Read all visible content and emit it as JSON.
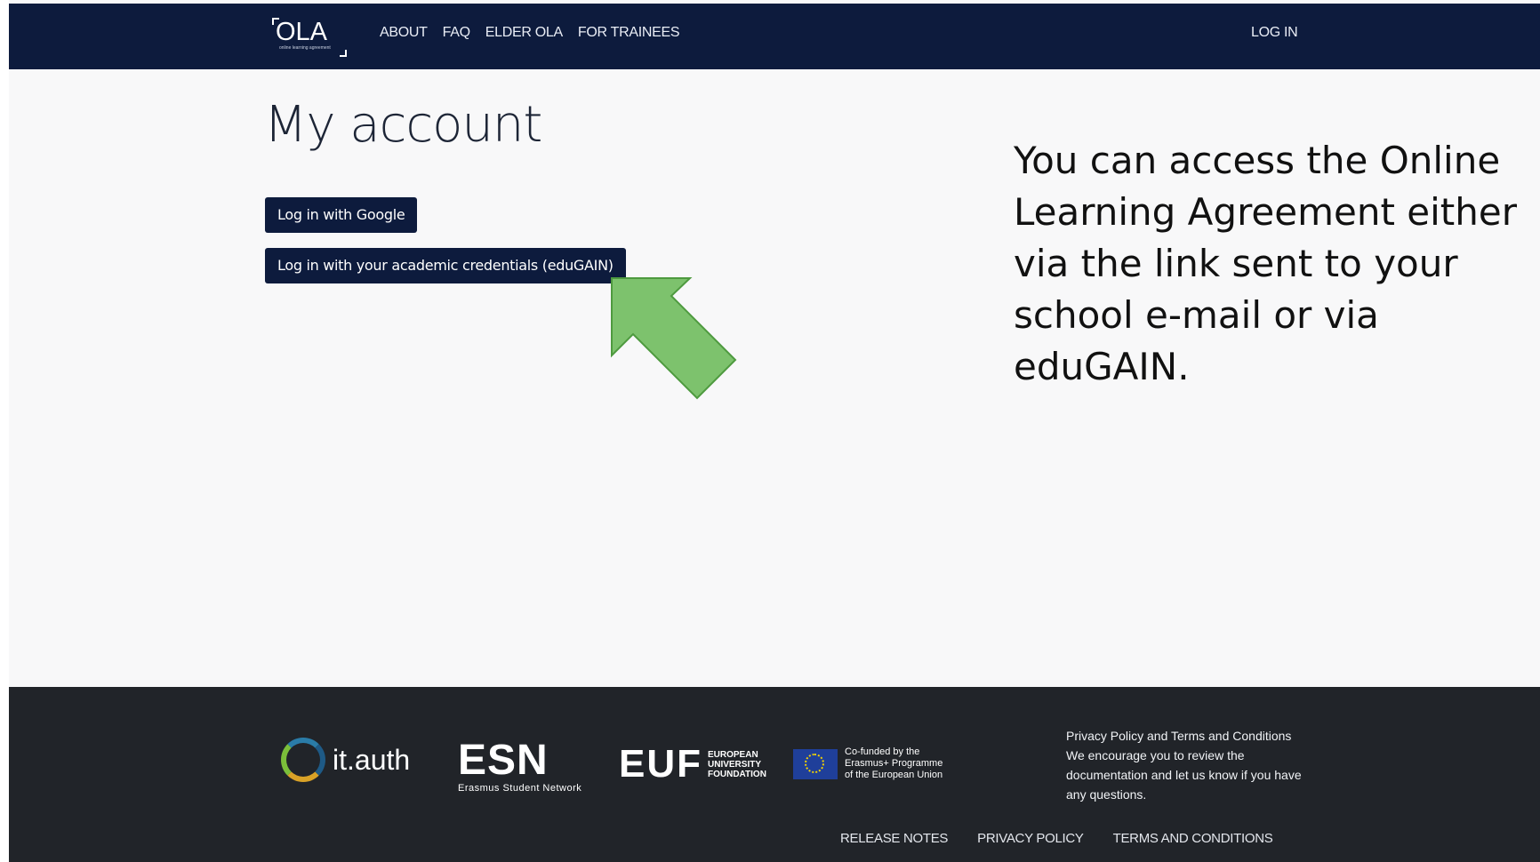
{
  "header": {
    "logo_text": "OLA",
    "logo_subtext": "online learning agreement",
    "nav": [
      "ABOUT",
      "FAQ",
      "ELDER OLA",
      "FOR TRAINEES"
    ],
    "login": "LOG IN"
  },
  "main": {
    "title": "My account",
    "button_google": "Log in with Google",
    "button_edugain": "Log in with your academic credentials (eduGAIN)"
  },
  "annotation": {
    "text": "You can access the Online Learning Agreement either via the link sent to your school e-mail or via eduGAIN.",
    "arrow_color": "#7dc26d"
  },
  "footer": {
    "itauth": "it.auth",
    "esn": "ESN",
    "esn_sub": "Erasmus Student Network",
    "euf": "EUF",
    "euf_sub_1": "EUROPEAN",
    "euf_sub_2": "UNIVERSITY",
    "euf_sub_3": "FOUNDATION",
    "eu_1": "Co-funded by the",
    "eu_2": "Erasmus+ Programme",
    "eu_3": "of the European Union",
    "policy_line1": "Privacy Policy and Terms and Conditions",
    "policy_line2": "We encourage you to review the documentation and let us know if you have any questions.",
    "links": [
      "RELEASE NOTES",
      "PRIVACY POLICY",
      "TERMS AND CONDITIONS"
    ]
  },
  "colors": {
    "navy": "#0d1b3d",
    "footer_bg": "#212429",
    "page_bg": "#f8f8f9"
  }
}
